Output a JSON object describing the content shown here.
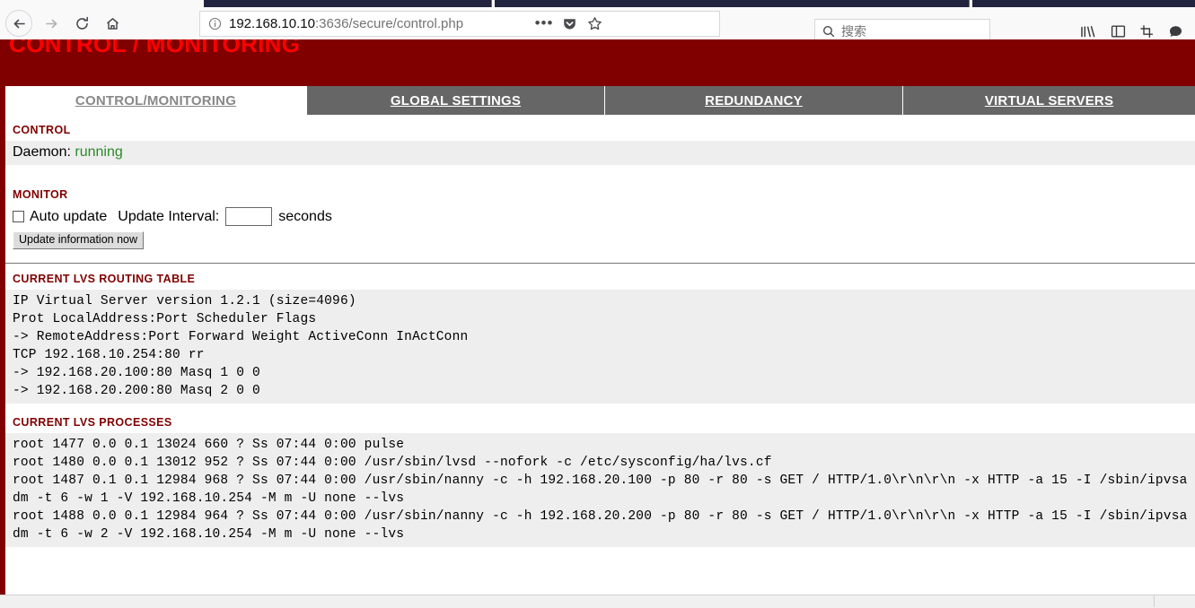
{
  "browser": {
    "back_icon": "back-arrow-icon",
    "forward_icon": "forward-arrow-icon",
    "reload_icon": "reload-icon",
    "home_icon": "home-icon",
    "identity_icon": "info-circle-icon",
    "url_host": "192.168.10.10",
    "url_rest": ":3636/secure/control.php",
    "url_full": "192.168.10.10:3636/secure/control.php",
    "page_actions_icon": "ellipsis-icon",
    "pocket_icon": "pocket-icon",
    "bookmark_icon": "star-icon",
    "search_icon": "search-icon",
    "search_placeholder": "搜索",
    "search_value": "",
    "library_icon": "library-icon",
    "sidebar_icon": "sidebar-icon",
    "screenshot_icon": "screenshot-icon",
    "chat_icon": "chat-bubble-icon"
  },
  "page": {
    "banner_title": "CONTROL / MONITORING",
    "banner_color": "#800000",
    "banner_text_color": "#ff0000",
    "tabs": [
      {
        "label": "CONTROL/MONITORING",
        "active": true
      },
      {
        "label": "GLOBAL SETTINGS",
        "active": false
      },
      {
        "label": "REDUNDANCY",
        "active": false
      },
      {
        "label": "VIRTUAL SERVERS",
        "active": false
      }
    ],
    "control": {
      "section_title": "CONTROL",
      "daemon_label": "Daemon:",
      "daemon_status": "running",
      "daemon_status_color": "#2a8a2a"
    },
    "monitor": {
      "section_title": "MONITOR",
      "auto_update_label": "Auto update",
      "auto_update_checked": false,
      "interval_label": "Update Interval:",
      "interval_value": "",
      "seconds_label": "seconds",
      "update_button_label": "Update information now"
    },
    "routing_table": {
      "section_title": "CURRENT LVS ROUTING TABLE",
      "lines": [
        "IP Virtual Server version 1.2.1 (size=4096)",
        "Prot LocalAddress:Port Scheduler Flags",
        "-> RemoteAddress:Port Forward Weight ActiveConn InActConn",
        "TCP 192.168.10.254:80 rr",
        "-> 192.168.20.100:80 Masq 1 0 0",
        "-> 192.168.20.200:80 Masq 2 0 0"
      ]
    },
    "processes": {
      "section_title": "CURRENT LVS PROCESSES",
      "lines": [
        "root 1477 0.0 0.1 13024 660 ? Ss 07:44 0:00 pulse",
        "root 1480 0.0 0.1 13012 952 ? Ss 07:44 0:00 /usr/sbin/lvsd --nofork -c /etc/sysconfig/ha/lvs.cf",
        "root 1487 0.1 0.1 12984 968 ? Ss 07:44 0:00 /usr/sbin/nanny -c -h 192.168.20.100 -p 80 -r 80 -s GET / HTTP/1.0\\r\\n\\r\\n -x HTTP -a 15 -I /sbin/ipvsadm -t 6 -w 1 -V 192.168.10.254 -M m -U none --lvs",
        "root 1488 0.0 0.1 12984 964 ? Ss 07:44 0:00 /usr/sbin/nanny -c -h 192.168.20.200 -p 80 -r 80 -s GET / HTTP/1.0\\r\\n\\r\\n -x HTTP -a 15 -I /sbin/ipvsadm -t 6 -w 2 -V 192.168.10.254 -M m -U none --lvs"
      ]
    }
  }
}
